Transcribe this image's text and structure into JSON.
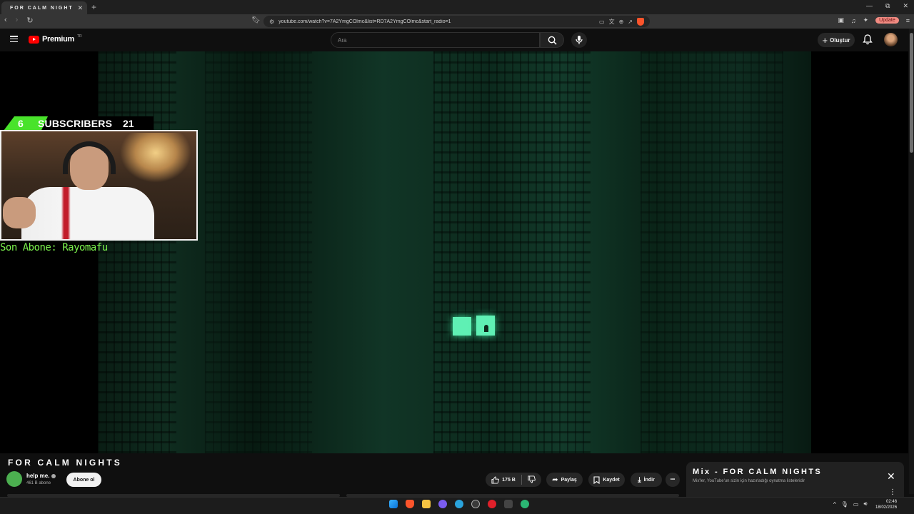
{
  "browser": {
    "tab_title": "FOR CALM NIGHT",
    "tab_close": "✕",
    "new_tab": "+",
    "window_controls": [
      "—",
      "⧉",
      "✕"
    ],
    "url": "youtube.com/watch?v=7A2YmgCOlmc&list=RD7A2YmgCOlmc&start_radio=1",
    "update_label": "Update"
  },
  "youtube": {
    "logo_text": "Premium",
    "logo_tr": "TR",
    "search_placeholder": "Ara",
    "create_label": "Oluştur"
  },
  "overlay": {
    "sub_left": "6",
    "sub_label": "SUBSCRIBERS",
    "sub_right": "21",
    "last_subscriber": "Son Abone: Rayomafu"
  },
  "video": {
    "title": "FOR CALM NIGHTS",
    "channel_name": "help me.",
    "channel_subs": "461 B abone",
    "subscribe_label": "Abone ol",
    "likes": "175 B",
    "share_label": "Paylaş",
    "save_label": "Kaydet",
    "download_label": "İndir",
    "more_label": "•••"
  },
  "mix": {
    "title": "Mix - FOR CALM NIGHTS",
    "subtitle": "Mix'ler, YouTube'un sizin için hazırladığı oynatma listeleridir",
    "close": "✕",
    "more": "⋮"
  },
  "taskbar": {
    "time": "02:46",
    "date": "18/02/2026",
    "tray_up": "^"
  },
  "colors": {
    "accent_red": "#ff0000",
    "overlay_green": "#49e32b",
    "last_sub_green": "#7cf24e",
    "video_glow": "#5ff0b4"
  }
}
